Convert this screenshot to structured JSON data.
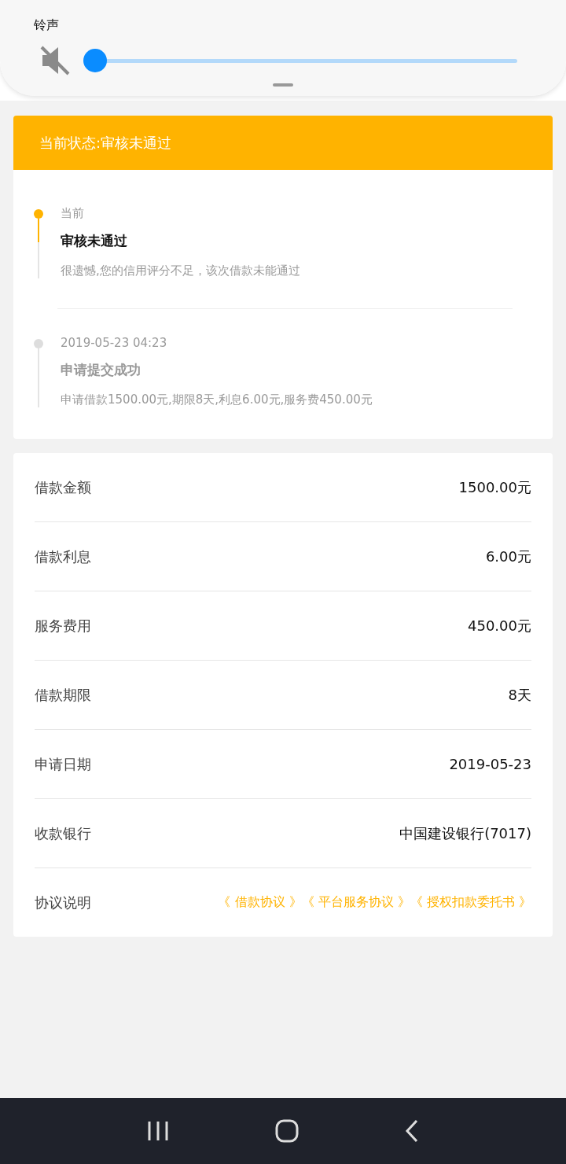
{
  "volume_panel": {
    "label": "铃声",
    "muted": true,
    "level": 0.0
  },
  "status_banner": "当前状态:审核未通过",
  "timeline": [
    {
      "current": true,
      "time": "当前",
      "title": "审核未通过",
      "detail": "很遗憾,您的信用评分不足，该次借款未能通过"
    },
    {
      "current": false,
      "time": "2019-05-23 04:23",
      "title": "申请提交成功",
      "detail": "申请借款1500.00元,期限8天,利息6.00元,服务费450.00元"
    }
  ],
  "details": [
    {
      "kind": "value",
      "label": "借款金额",
      "value": "1500.00元"
    },
    {
      "kind": "value",
      "label": "借款利息",
      "value": "6.00元"
    },
    {
      "kind": "value",
      "label": "服务费用",
      "value": "450.00元"
    },
    {
      "kind": "value",
      "label": "借款期限",
      "value": "8天"
    },
    {
      "kind": "value",
      "label": "申请日期",
      "value": "2019-05-23"
    },
    {
      "kind": "value",
      "label": "收款银行",
      "value": "中国建设银行(7017)"
    },
    {
      "kind": "links",
      "label": "协议说明",
      "links": [
        "《 借款协议 》",
        "《 平台服务协议 》",
        "《 授权扣款委托书 》"
      ]
    }
  ]
}
